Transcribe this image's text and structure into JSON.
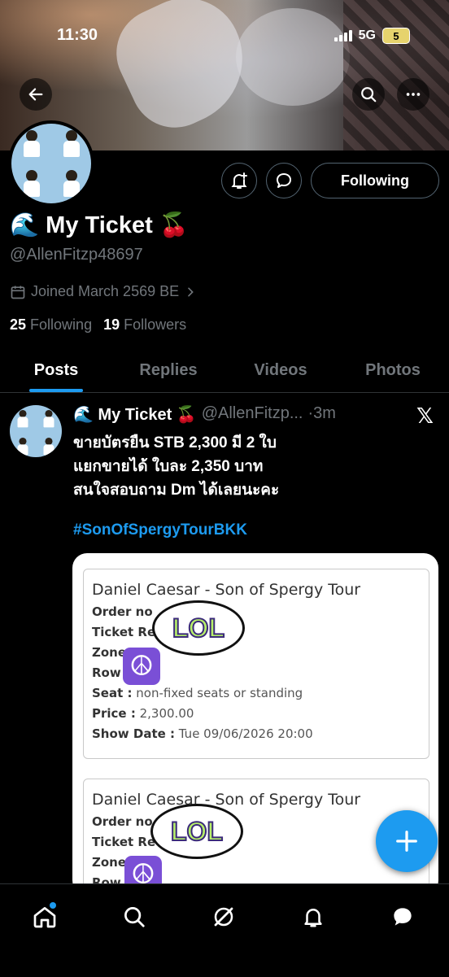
{
  "status_bar": {
    "time": "11:30",
    "network": "5G",
    "battery": "5"
  },
  "profile": {
    "display_name": "🌊 My Ticket 🍒",
    "handle": "@AllenFitzp48697",
    "joined": "Joined March 2569 BE",
    "following_count": "25",
    "following_label": "Following",
    "followers_count": "19",
    "followers_label": "Followers",
    "follow_button": "Following"
  },
  "tabs": [
    {
      "label": "Posts",
      "active": true
    },
    {
      "label": "Replies",
      "active": false
    },
    {
      "label": "Videos",
      "active": false
    },
    {
      "label": "Photos",
      "active": false
    }
  ],
  "post": {
    "author_name": "🌊 My Ticket 🍒",
    "author_handle": "@AllenFitzp...",
    "time": "·3m",
    "lines": [
      "ขายบัตรยืน STB 2,300 มี 2 ใบ",
      "แยกขายได้ ใบละ 2,350 บาท",
      "สนใจสอบถาม Dm ได้เลยนะคะ"
    ],
    "hashtag": "#SonOfSpergyTourBKK"
  },
  "ticket_1": {
    "title": "Daniel Caesar - Son of Spergy Tour",
    "order_label": "Order no",
    "ref_label": "Ticket Ref",
    "zone_label": "Zone",
    "row_label": "Row :",
    "seat_label": "Seat :",
    "seat_value": "non-fixed seats or standing",
    "price_label": "Price :",
    "price_value": "2,300.00",
    "date_label": "Show Date :",
    "date_value": "Tue 09/06/2026 20:00"
  },
  "ticket_2": {
    "title": "Daniel Caesar - Son of Spergy Tour",
    "order_label": "Order no",
    "ref_label": "Ticket Re",
    "zone_label": "Zone",
    "row_label": "Row"
  },
  "sticker_text": "LOL",
  "colors": {
    "accent": "#1d9bf0",
    "background": "#000000",
    "muted": "#71767b"
  }
}
